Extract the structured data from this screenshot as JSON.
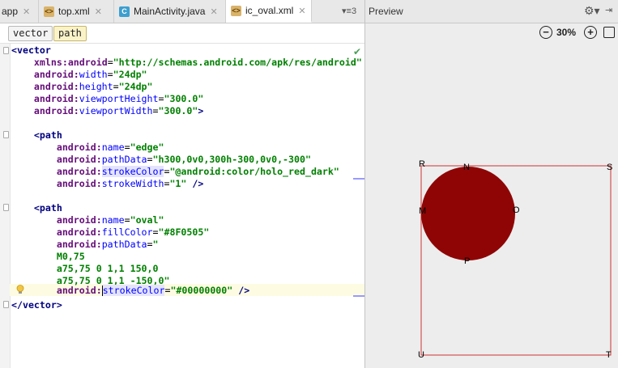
{
  "tabs": [
    {
      "label": "app",
      "icon": "android-module-icon"
    },
    {
      "label": "top.xml",
      "icon": "xml-file-icon"
    },
    {
      "label": "MainActivity.java",
      "icon": "java-class-icon"
    },
    {
      "label": "ic_oval.xml",
      "icon": "xml-file-icon",
      "active": true
    }
  ],
  "tab_overflow": "3",
  "breadcrumb": [
    "vector",
    "path"
  ],
  "preview": {
    "title": "Preview",
    "zoom": "30%",
    "labels": {
      "R": "R",
      "N": "N",
      "S": "S",
      "M": "M",
      "O": "O",
      "P": "P",
      "U": "U",
      "T": "T"
    },
    "oval_color": "#8F0505",
    "edge_color": "#CC0000"
  },
  "code": {
    "l1_tag": "<vector",
    "xmlns_ns": "xmlns:",
    "xmlns_attr": "android",
    "xmlns_val": "\"http://schemas.android.com/apk/res/android\"",
    "android": "android:",
    "width_attr": "width",
    "width_val": "\"24dp\"",
    "height_attr": "height",
    "height_val": "\"24dp\"",
    "vph_attr": "viewportHeight",
    "vph_val": "\"300.0\"",
    "vpw_attr": "viewportWidth",
    "vpw_val": "\"300.0\"",
    "gt": ">",
    "path_tag": "<path",
    "name_attr": "name",
    "edge_val": "\"edge\"",
    "pathdata_attr": "pathData",
    "edge_pathdata_val": "\"h300,0v0,300h-300,0v0,-300\"",
    "strokecolor_attr": "strokeColor",
    "edge_stroke_val": "\"@android:color/holo_red_dark\"",
    "strokewidth_attr": "strokeWidth",
    "strokewidth_val": "\"1\"",
    "close": " />",
    "oval_val": "\"oval\"",
    "fillcolor_attr": "fillColor",
    "fillcolor_val": "\"#8F0505\"",
    "oval_pathdata_open": "\"",
    "pd1": "M0,75",
    "pd2": "a75,75 0 1,1 150,0",
    "pd3": "a75,75 0 1,1 -150,0\"",
    "oval_stroke_val": "\"#00000000\"",
    "end_tag": "</vector>"
  },
  "colors": {
    "oval_fill": "#8F0505"
  }
}
